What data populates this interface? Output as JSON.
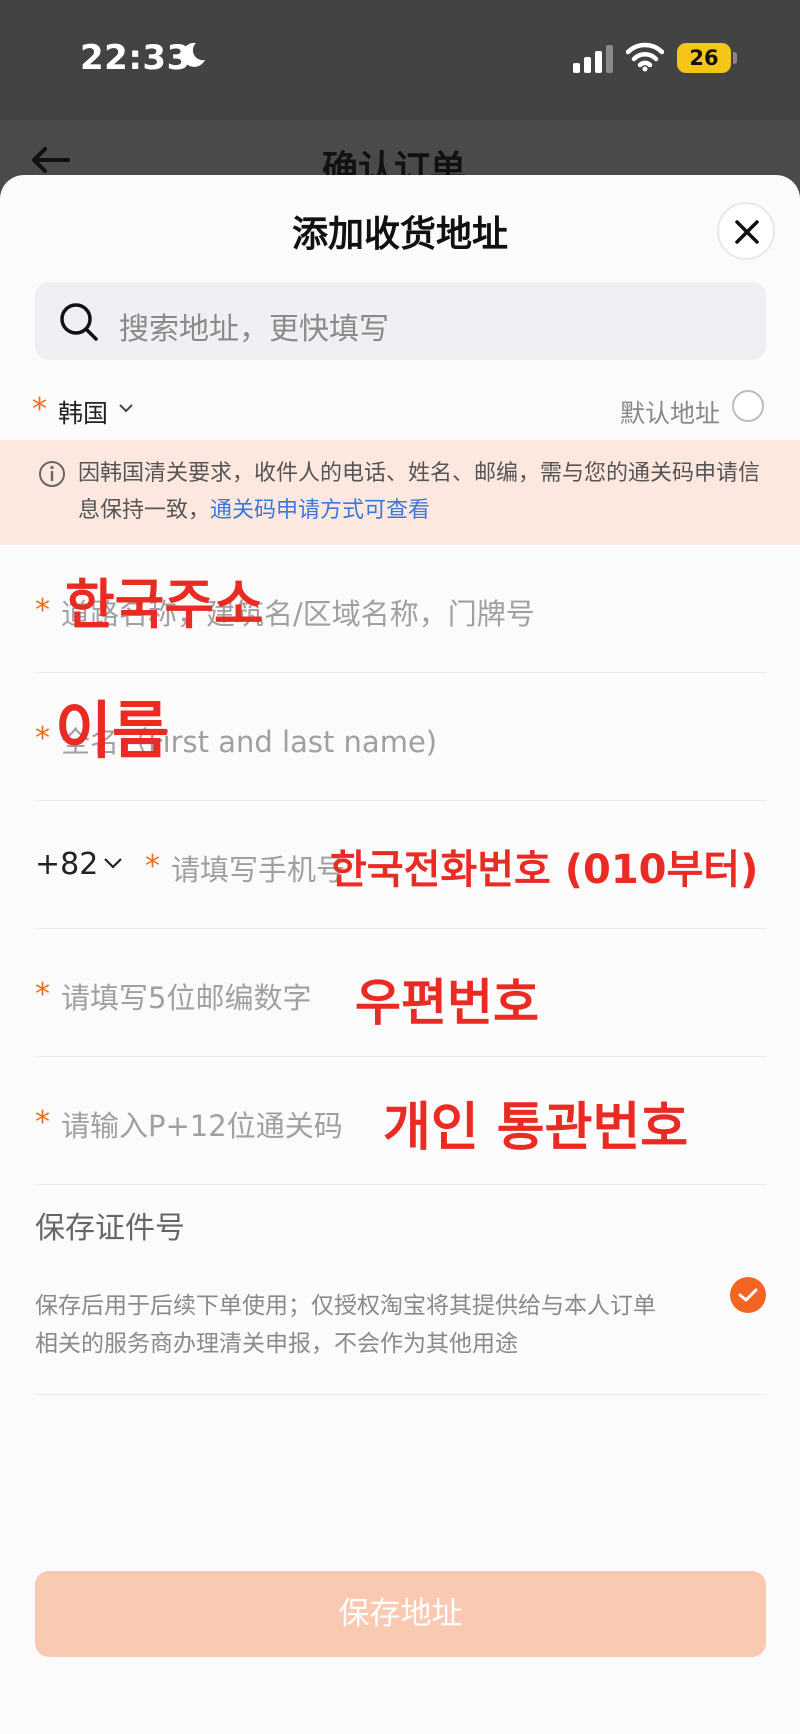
{
  "status_bar": {
    "time": "22:33",
    "battery": "26"
  },
  "behind_page": {
    "title": "确认订单"
  },
  "sheet": {
    "title": "添加收货地址"
  },
  "search": {
    "placeholder": "搜索地址，更快填写"
  },
  "country": {
    "label": "韩国",
    "default_label": "默认地址"
  },
  "notice": {
    "text": "因韩国清关要求，收件人的电话、姓名、邮编，需与您的通关码申请信息保持一致，",
    "link": "通关码申请方式可查看"
  },
  "fields": {
    "address_placeholder": "道路名称，建筑名/区域名称，门牌号",
    "name_placeholder": "全名（First and last name)",
    "phone_prefix": "+82",
    "phone_placeholder": "请填写手机号",
    "postcode_placeholder": "请填写5位邮编数字",
    "customs_placeholder": "请输入P+12位通关码"
  },
  "annotations": {
    "address": "한국주소",
    "name": "이름",
    "phone": "한국전화번호 (010부터)",
    "postcode": "우편번호",
    "customs": "개인 통관번호"
  },
  "save_id": {
    "title": "保存证件号",
    "description": "保存后用于后续下单使用；仅授权淘宝将其提供给与本人订单相关的服务商办理清关申报，不会作为其他用途",
    "checked": true
  },
  "save_button": "保存地址",
  "colors": {
    "accent": "#f26522",
    "link": "#3b78d8",
    "annotation": "#ea2b24"
  }
}
